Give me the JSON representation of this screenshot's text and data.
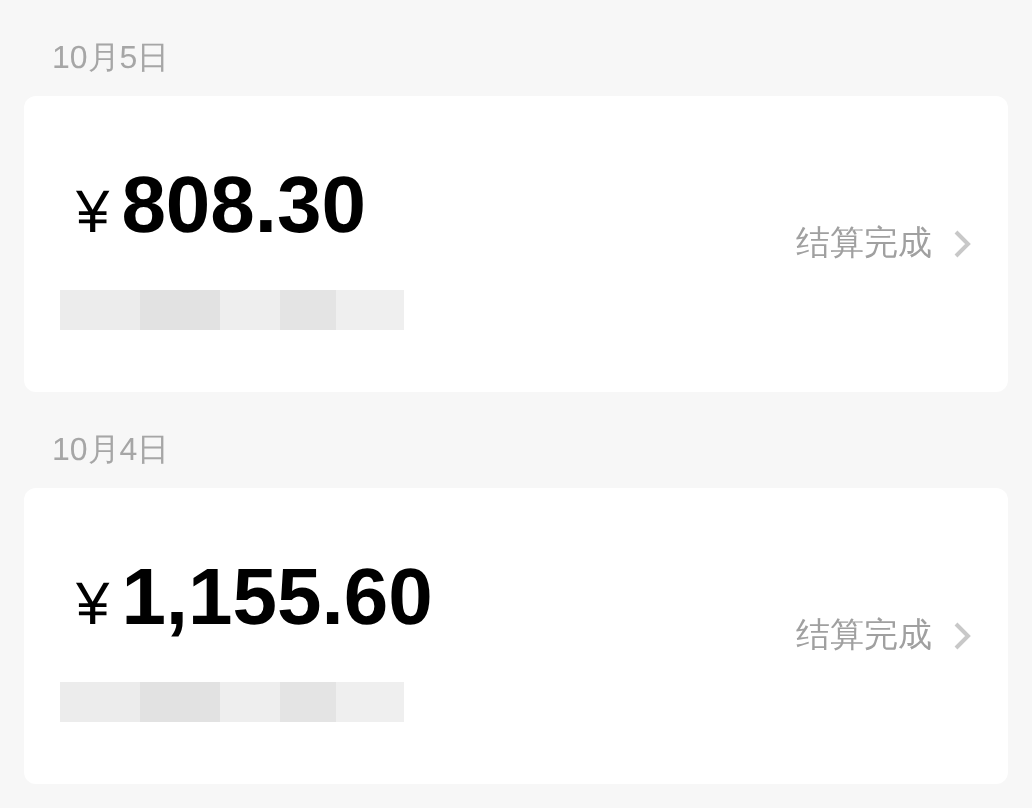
{
  "records": [
    {
      "date": "10月5日",
      "currency": "¥",
      "amount": "808.30",
      "status": "结算完成"
    },
    {
      "date": "10月4日",
      "currency": "¥",
      "amount": "1,155.60",
      "status": "结算完成"
    }
  ]
}
